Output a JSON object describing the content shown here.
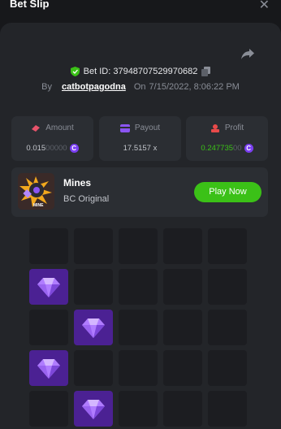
{
  "header": {
    "title": "Bet Slip",
    "close_icon": "close-icon"
  },
  "bet": {
    "id_text": "Bet ID: 37948707529970682",
    "by_label": "By",
    "user": "catbotpagodna",
    "on_label": "On",
    "datetime": "7/15/2022, 8:06:22 PM"
  },
  "stats": {
    "amount": {
      "label": "Amount",
      "value_main": "0.015",
      "value_dim": "00000"
    },
    "payout": {
      "label": "Payout",
      "value": "17.5157 x"
    },
    "profit": {
      "label": "Profit",
      "value_main": "0.247735",
      "value_dim": "00"
    }
  },
  "game": {
    "name": "Mines",
    "subtitle": "BC Original",
    "play_label": "Play Now",
    "thumb_label": "MINE"
  },
  "grid": {
    "columns": 5,
    "visible_rows": 5,
    "cells": [
      [
        "empty",
        "empty",
        "empty",
        "empty",
        "empty"
      ],
      [
        "gem",
        "empty",
        "empty",
        "empty",
        "empty"
      ],
      [
        "empty",
        "gem",
        "empty",
        "empty",
        "empty"
      ],
      [
        "gem",
        "empty",
        "empty",
        "empty",
        "empty"
      ],
      [
        "empty",
        "gem",
        "empty",
        "empty",
        "empty"
      ]
    ]
  },
  "colors": {
    "accent_green": "#3bc117",
    "gem_purple": "#4b2193",
    "background": "#17181b",
    "panel": "#232529"
  }
}
